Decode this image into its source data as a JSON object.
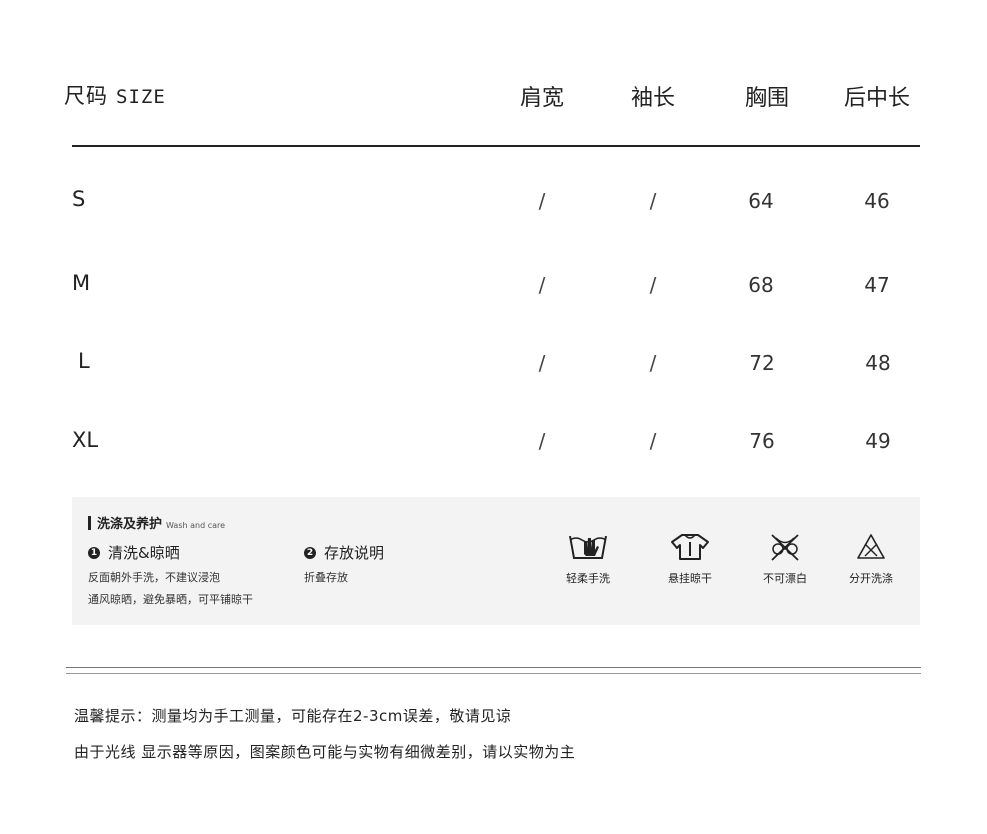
{
  "header": {
    "title": "尺码",
    "title_en": "SIZE",
    "columns": [
      "肩宽",
      "袖长",
      "胸围",
      "后中长"
    ]
  },
  "rows": [
    {
      "size": "S",
      "shoulder": "/",
      "sleeve": "/",
      "chest": "64",
      "length": "46"
    },
    {
      "size": "M",
      "shoulder": "/",
      "sleeve": "/",
      "chest": "68",
      "length": "47"
    },
    {
      "size": "L",
      "shoulder": "/",
      "sleeve": "/",
      "chest": "72",
      "length": "48"
    },
    {
      "size": "XL",
      "shoulder": "/",
      "sleeve": "/",
      "chest": "76",
      "length": "49"
    }
  ],
  "care": {
    "title": "洗涤及养护",
    "title_en": "Wash and care",
    "item1": {
      "num": "1",
      "heading": "清洗&晾晒",
      "line1": "反面朝外手洗，不建议浸泡",
      "line2": "通风晾晒，避免暴晒，可平铺晾干"
    },
    "item2": {
      "num": "2",
      "heading": "存放说明",
      "line1": "折叠存放"
    },
    "icons": [
      {
        "icon": "hand-wash-icon",
        "label": "轻柔手洗"
      },
      {
        "icon": "hang-dry-icon",
        "label": "悬挂晾干"
      },
      {
        "icon": "no-bleach-icon",
        "label": "不可漂白"
      },
      {
        "icon": "wash-separately-icon",
        "label": "分开洗涤"
      }
    ]
  },
  "notes": {
    "line1": "温馨提示：测量均为手工测量，可能存在2-3cm误差，敬请见谅",
    "line2": "由于光线 显示器等原因，图案颜色可能与实物有细微差别，请以实物为主"
  }
}
